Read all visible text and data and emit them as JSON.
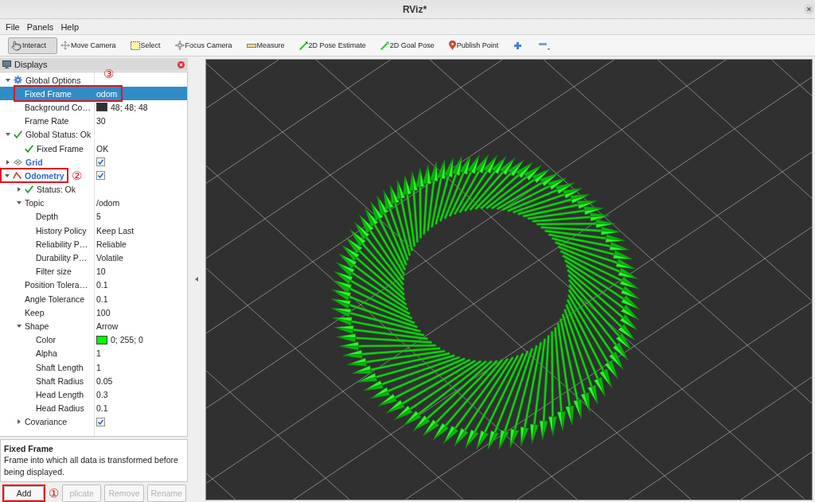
{
  "window": {
    "title": "RViz*"
  },
  "menu": [
    "File",
    "Panels",
    "Help"
  ],
  "toolbar": [
    {
      "kind": "interact",
      "label": "Interact",
      "selected": true
    },
    {
      "kind": "move",
      "label": "Move Camera",
      "selected": false
    },
    {
      "kind": "select",
      "label": "Select",
      "selected": false
    },
    {
      "kind": "focus",
      "label": "Focus Camera",
      "selected": false
    },
    {
      "kind": "measure",
      "label": "Measure",
      "selected": false
    },
    {
      "kind": "pose",
      "label": "2D Pose Estimate",
      "selected": false
    },
    {
      "kind": "goal",
      "label": "2D Goal Pose",
      "selected": false
    },
    {
      "kind": "point",
      "label": "Publish Point",
      "selected": false
    }
  ],
  "displays_panel": {
    "title": "Displays",
    "tree": [
      {
        "kind": "options",
        "label": "Global Options",
        "selected": false,
        "expanded": true,
        "children": [
          {
            "label": "Fixed Frame",
            "value": "odom",
            "selected": true,
            "callout": "③"
          },
          {
            "label": "Background Co…",
            "value": "48; 48; 48",
            "color": "#303030",
            "selected": false
          },
          {
            "label": "Frame Rate",
            "value": "30",
            "selected": false
          }
        ]
      },
      {
        "kind": "status",
        "label": "Global Status: Ok",
        "selected": false,
        "expanded": true,
        "children": [
          {
            "kind": "status",
            "label": "Fixed Frame",
            "value": "OK",
            "selected": false
          }
        ]
      },
      {
        "kind": "grid",
        "label": "Grid",
        "selected": false,
        "expanded": false,
        "checked": true
      },
      {
        "kind": "odometry",
        "label": "Odometry",
        "selected": false,
        "expanded": true,
        "checked": true,
        "callout": "②",
        "children": [
          {
            "kind": "status",
            "label": "Status: Ok",
            "selected": false,
            "expanded": false
          },
          {
            "label": "Topic",
            "value": "/odom",
            "selected": false,
            "expanded": true,
            "children": [
              {
                "label": "Depth",
                "value": "5",
                "selected": false
              },
              {
                "label": "History Policy",
                "value": "Keep Last",
                "selected": false
              },
              {
                "label": "Reliability P…",
                "value": "Reliable",
                "selected": false
              },
              {
                "label": "Durability P…",
                "value": "Volatile",
                "selected": false
              },
              {
                "label": "Filter size",
                "value": "10",
                "selected": false
              }
            ]
          },
          {
            "label": "Position Tolera…",
            "value": "0.1",
            "selected": false
          },
          {
            "label": "Angle Tolerance",
            "value": "0.1",
            "selected": false
          },
          {
            "label": "Keep",
            "value": "100",
            "selected": false
          },
          {
            "label": "Shape",
            "value": "Arrow",
            "selected": false,
            "expanded": true,
            "children": [
              {
                "label": "Color",
                "value": "0; 255; 0",
                "color": "#00ff00",
                "selected": false
              },
              {
                "label": "Alpha",
                "value": "1",
                "selected": false
              },
              {
                "label": "Shaft Length",
                "value": "1",
                "selected": false
              },
              {
                "label": "Shaft Radius",
                "value": "0.05",
                "selected": false
              },
              {
                "label": "Head Length",
                "value": "0.3",
                "selected": false
              },
              {
                "label": "Head Radius",
                "value": "0.1",
                "selected": false
              }
            ]
          },
          {
            "label": "Covariance",
            "checked": true,
            "selected": false,
            "expanded": false
          }
        ]
      }
    ],
    "description": {
      "title": "Fixed Frame",
      "text": "Frame into which all data is transformed before being displayed."
    },
    "buttons": [
      {
        "label": "Add",
        "disabled": false,
        "callout": "①"
      },
      {
        "label": "plicate",
        "disabled": true
      },
      {
        "label": "Remove",
        "disabled": true
      },
      {
        "label": "Rename",
        "disabled": true
      }
    ]
  }
}
